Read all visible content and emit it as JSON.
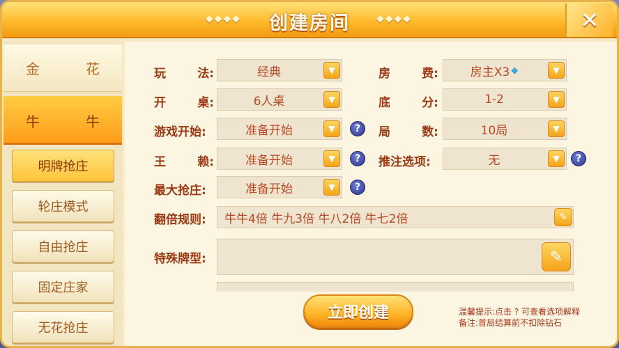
{
  "window": {
    "title": "创建房间",
    "title_deco_left": "◆◆◆◆",
    "title_deco_right": "◆◆◆◆"
  },
  "sidebar": {
    "games": [
      {
        "left": "金",
        "right": "花"
      },
      {
        "left": "牛",
        "right": "牛"
      }
    ],
    "modes": [
      "明牌抢庄",
      "轮庄模式",
      "自由抢庄",
      "固定庄家",
      "无花抢庄"
    ],
    "selected_mode": "明牌抢庄"
  },
  "form": {
    "play_label": [
      "玩",
      "法:"
    ],
    "play_value": "经典",
    "table_label": [
      "开",
      "桌:"
    ],
    "table_value": "6人桌",
    "start_label": "游戏开始:",
    "start_value": "准备开始",
    "wild_label": [
      "王",
      "赖:"
    ],
    "wild_value": "准备开始",
    "max_bank_label": "最大抢庄:",
    "max_bank_value": "准备开始",
    "fee_label": [
      "房",
      "费:"
    ],
    "fee_value": "房主X3",
    "base_label": [
      "底",
      "分:"
    ],
    "base_value": "1-2",
    "rounds_label": [
      "局",
      "数:"
    ],
    "rounds_value": "10局",
    "push_label": "推注选项:",
    "push_value": "无",
    "double_label": "翻倍规则:",
    "double_value": "牛牛4倍 牛九3倍 牛八2倍 牛七2倍",
    "special_label": "特殊牌型:",
    "special_value": "",
    "help_glyph": "?"
  },
  "footer": {
    "create_label": "立即创建",
    "hint_line1": "温馨提示:点击 ? 可查看选项解释",
    "hint_line2": "备注:首局结算前不扣除钻石"
  },
  "colors": {
    "accent": "#ffb426",
    "label": "#9b3a14",
    "value": "#b64a24"
  }
}
